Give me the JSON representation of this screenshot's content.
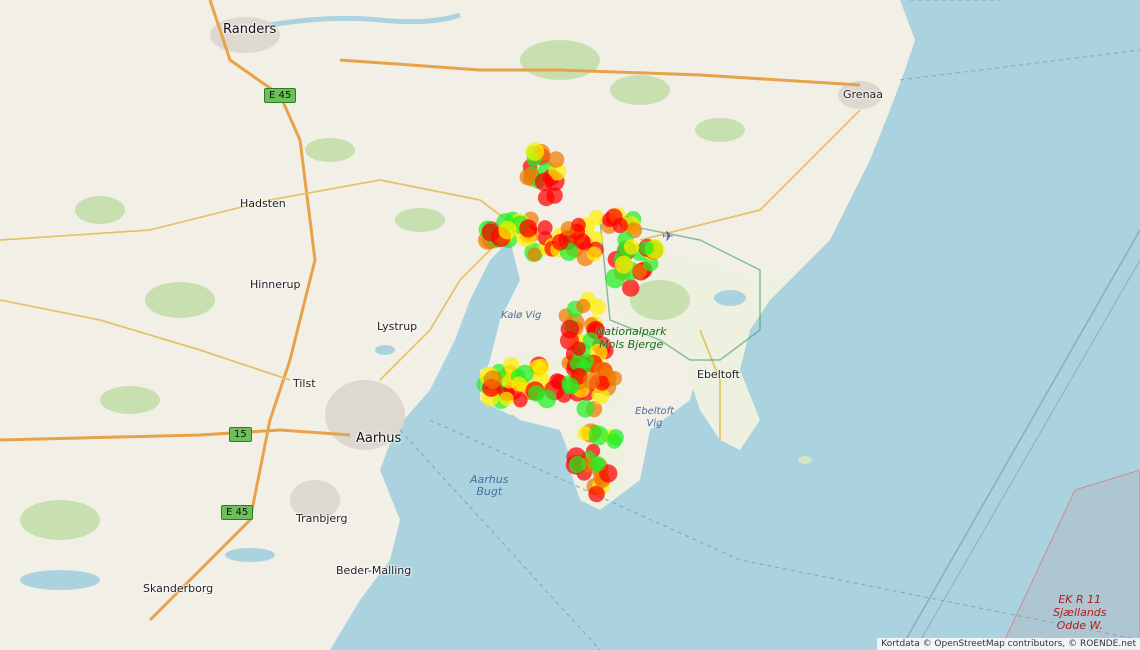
{
  "places": {
    "randers": "Randers",
    "grenaa": "Grenaa",
    "hadsten": "Hadsten",
    "hinnerup": "Hinnerup",
    "lystrup": "Lystrup",
    "tilst": "Tilst",
    "aarhus": "Aarhus",
    "ebeltoft": "Ebeltoft",
    "tranbjerg": "Tranbjerg",
    "beder": "Beder-Malling",
    "skanderborg": "Skanderborg"
  },
  "water": {
    "kalo_vig": "Kalø Vig",
    "ebeltoft_vig_1": "Ebeltoft",
    "ebeltoft_vig_2": "Vig",
    "aarhus_bugt_1": "Aarhus",
    "aarhus_bugt_2": "Bugt"
  },
  "park": {
    "line1": "Nationalpark",
    "line2": "Mols Bjerge"
  },
  "roads": {
    "e45_north": "E 45",
    "r15": "15",
    "e45_south": "E 45"
  },
  "restricted_area": {
    "line1": "EK R 11",
    "line2": "Sjællands",
    "line3": "Odde W."
  },
  "attribution": "Kortdata © OpenStreetMap contributors, © ROENDE.net",
  "marker_colors": {
    "red": "#ff0000",
    "orange": "#f07800",
    "yellow": "#ffee00",
    "green": "#22ee22"
  }
}
